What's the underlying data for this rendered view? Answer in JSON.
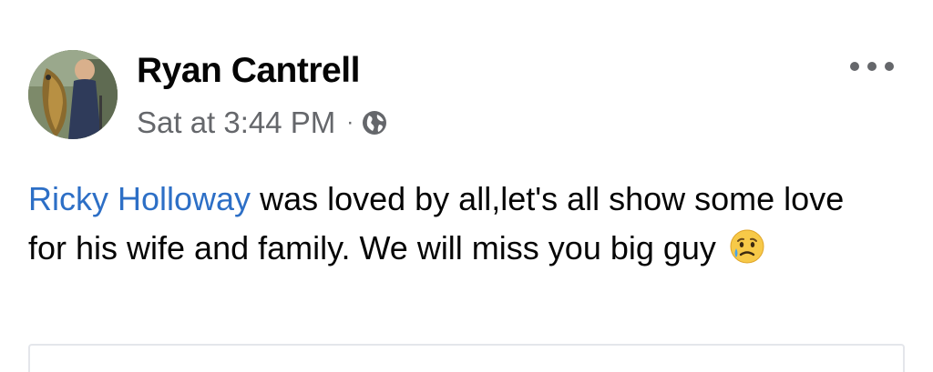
{
  "post": {
    "author": {
      "name": "Ryan Cantrell",
      "avatar_icon": "profile-photo-icon"
    },
    "meta": {
      "timestamp": "Sat at 3:44 PM",
      "separator": "·",
      "privacy_icon": "globe-icon"
    },
    "more_icon": "more-options-icon",
    "body": {
      "mention": "Ricky Holloway",
      "text": " was loved by all,let's all show some love for his wife and family. We will miss you big guy",
      "emoji_icon": "sad-but-relieved-face-emoji"
    }
  },
  "colors": {
    "text_primary": "#050505",
    "text_secondary": "#65676b",
    "mention_link": "#2d6fc6",
    "background": "#ffffff",
    "card_border": "#e4e6eb"
  }
}
